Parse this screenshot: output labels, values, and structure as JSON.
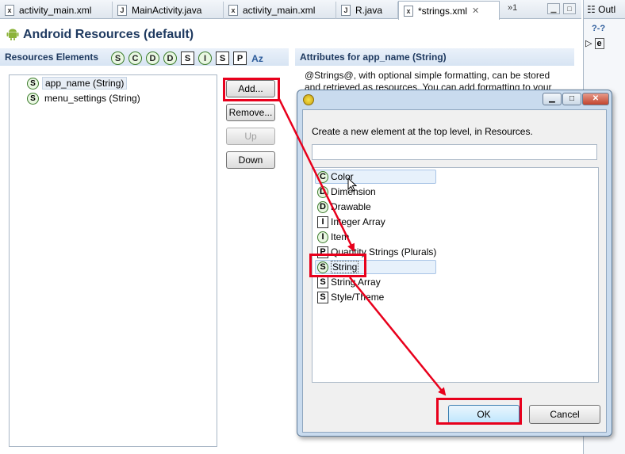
{
  "tabs": [
    {
      "label": "activity_main.xml",
      "icon": "xml-file-icon",
      "glyph": "x"
    },
    {
      "label": "MainActivity.java",
      "icon": "java-file-icon",
      "glyph": "J"
    },
    {
      "label": "activity_main.xml",
      "icon": "xml-file-icon",
      "glyph": "x"
    },
    {
      "label": "R.java",
      "icon": "java-file-icon",
      "glyph": "J"
    },
    {
      "label": "*strings.xml",
      "icon": "xml-file-icon",
      "glyph": "x",
      "active": true
    }
  ],
  "tab_overflow": "»1",
  "outline": {
    "tab_label": "Outl",
    "row1": "?-?",
    "row2": "e"
  },
  "header": {
    "title": "Android Resources (default)"
  },
  "resources": {
    "heading": "Resources Elements",
    "filter_icons": [
      "S",
      "C",
      "D",
      "D",
      "S",
      "I",
      "S",
      "P"
    ],
    "sort_label": "Az",
    "items": [
      {
        "icon": "S",
        "label": "app_name (String)",
        "selected": true
      },
      {
        "icon": "S",
        "label": "menu_settings (String)"
      }
    ]
  },
  "side_buttons": {
    "add": "Add...",
    "remove": "Remove...",
    "up": "Up",
    "down": "Down"
  },
  "attributes": {
    "heading": "Attributes for app_name (String)",
    "line1": "@Strings@, with optional simple formatting, can be stored",
    "line2": "and retrieved as resources. You can add formatting to your"
  },
  "dialog": {
    "prompt": "Create a new element at the top level, in Resources.",
    "search_value": "",
    "items": [
      {
        "icon": "C",
        "shape": "circle",
        "label": "Color"
      },
      {
        "icon": "D",
        "shape": "circle",
        "label": "Dimension"
      },
      {
        "icon": "D",
        "shape": "circle",
        "label": "Drawable"
      },
      {
        "icon": "I",
        "shape": "square",
        "label": "Integer Array"
      },
      {
        "icon": "I",
        "shape": "circle",
        "label": "Item"
      },
      {
        "icon": "P",
        "shape": "square",
        "label": "Quantity Strings (Plurals)"
      },
      {
        "icon": "S",
        "shape": "circle",
        "label": "String",
        "selected": true
      },
      {
        "icon": "S",
        "shape": "square",
        "label": "String Array"
      },
      {
        "icon": "S",
        "shape": "square",
        "label": "Style/Theme"
      }
    ],
    "ok_label": "OK",
    "cancel_label": "Cancel"
  },
  "colors": {
    "highlight": "#e8001c",
    "accent": "#1f3a60"
  }
}
